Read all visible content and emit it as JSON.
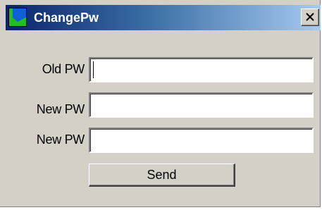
{
  "window": {
    "title": "ChangePw",
    "icon": "app-icon",
    "close_icon": "close-icon",
    "titlebar_colors": [
      "#0a246a",
      "#3a6ea5",
      "#a6caf0"
    ]
  },
  "form": {
    "old_pw_label": "Old PW",
    "old_pw_value": "",
    "new_pw_label": "New PW",
    "new_pw_value": "",
    "confirm_pw_label": "New PW",
    "confirm_pw_value": "",
    "send_label": "Send"
  }
}
